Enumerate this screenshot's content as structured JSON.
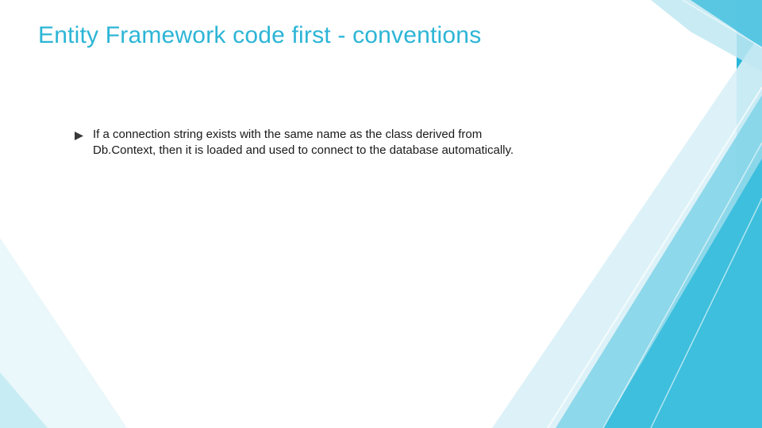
{
  "title": "Entity Framework code first - conventions",
  "bullets": [
    "If a connection string exists with the same name as the class derived from Db.Context, then it is loaded and used to connect to the database automatically."
  ],
  "colors": {
    "accent": "#2cb5d6",
    "text": "#1a1a1a",
    "deco_light": "#bfe8f2",
    "deco_mid": "#4cc3e0",
    "deco_dark": "#0a99c6"
  }
}
